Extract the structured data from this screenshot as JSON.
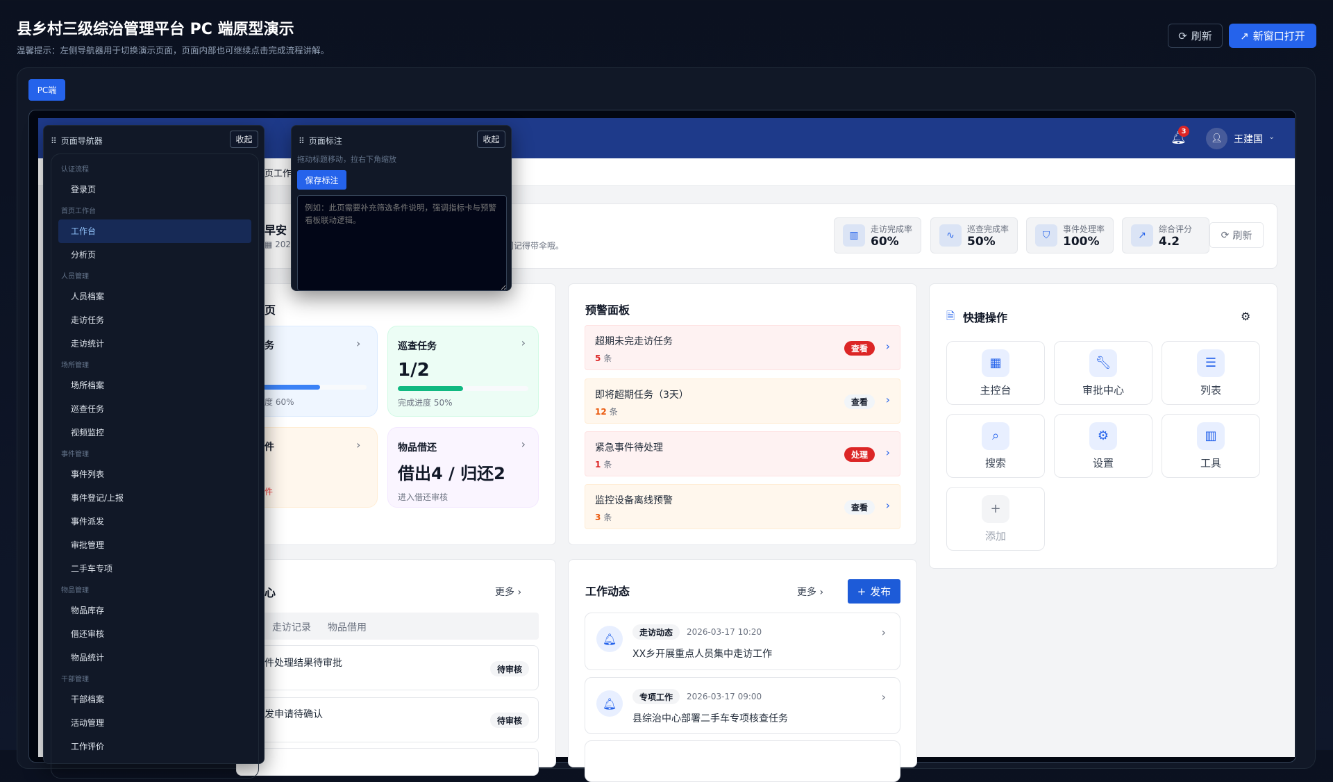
{
  "header": {
    "title": "县乡村三级综治管理平台 PC 端原型演示",
    "subtitle": "温馨提示：左侧导航器用于切换演示页面，页面内部也可继续点击完成流程讲解。",
    "refresh_label": "刷新",
    "open_new_label": "新窗口打开"
  },
  "device_tab": "PC端",
  "app": {
    "notification_count": "3",
    "user_name": "王建国",
    "breadcrumb_fragment": "页工作",
    "welcome": {
      "greeting_fragment": "早安 ,",
      "date_fragment": "202",
      "tip_fragment": "门记得带伞哦。"
    },
    "stats": [
      {
        "label": "走访完成率",
        "value": "60%",
        "icon": "bar-chart-icon"
      },
      {
        "label": "巡查完成率",
        "value": "50%",
        "icon": "activity-icon"
      },
      {
        "label": "事件处理率",
        "value": "100%",
        "icon": "shield-alert-icon"
      },
      {
        "label": "综合评分",
        "value": "4.2",
        "icon": "arrow-up-right-icon"
      }
    ],
    "stats_refresh": "刷新",
    "tasks": {
      "title_fragment": "页",
      "cards": [
        {
          "title_fragment": "务",
          "progress_label_fragment": "度 60%",
          "progress": 60,
          "color": "#3b82f6"
        },
        {
          "title": "巡查任务",
          "value": "1/2",
          "progress_label": "完成进度 50%",
          "progress": 50,
          "color": "#10b981"
        },
        {
          "title_fragment": "件",
          "sub_fragment": "件"
        },
        {
          "title": "物品借还",
          "value": "借出4 / 归还2",
          "sub": "进入借还审核"
        }
      ]
    },
    "alerts": {
      "title": "预警面板",
      "items": [
        {
          "title": "超期未完走访任务",
          "count": "5",
          "unit": "条",
          "action": "查看",
          "level": "danger"
        },
        {
          "title": "即将超期任务（3天）",
          "count": "12",
          "unit": "条",
          "action": "查看",
          "level": "warning"
        },
        {
          "title": "紧急事件待处理",
          "count": "1",
          "unit": "条",
          "action": "处理",
          "level": "danger"
        },
        {
          "title": "监控设备离线预警",
          "count": "3",
          "unit": "条",
          "action": "查看",
          "level": "warning"
        }
      ]
    },
    "quick": {
      "title": "快捷操作",
      "items": [
        {
          "label": "主控台",
          "icon": "grid-icon"
        },
        {
          "label": "审批中心",
          "icon": "wrench-icon"
        },
        {
          "label": "列表",
          "icon": "list-icon"
        },
        {
          "label": "搜索",
          "icon": "search-icon"
        },
        {
          "label": "设置",
          "icon": "gear-icon"
        },
        {
          "label": "工具",
          "icon": "bar-chart-icon"
        },
        {
          "label": "添加",
          "icon": "plus-icon"
        }
      ]
    },
    "todo": {
      "title_fragment": "心",
      "more": "更多",
      "tabs": [
        "走访记录",
        "物品借用"
      ],
      "items": [
        {
          "text_fragment": "件处理结果待审批",
          "status": "待审核"
        },
        {
          "text_fragment": "发申请待确认",
          "status": "待审核"
        }
      ]
    },
    "feed": {
      "title": "工作动态",
      "more": "更多",
      "publish": "发布",
      "items": [
        {
          "tag": "走访动态",
          "time": "2026-03-17 10:20",
          "text": "XX乡开展重点人员集中走访工作"
        },
        {
          "tag": "专项工作",
          "time": "2026-03-17 09:00",
          "text": "县综治中心部署二手车专项核查任务"
        }
      ]
    }
  },
  "navigator": {
    "title": "页面导航器",
    "collapse": "收起",
    "sections": [
      {
        "label": "认证流程",
        "items": [
          "登录页"
        ]
      },
      {
        "label": "首页工作台",
        "items": [
          "工作台",
          "分析页"
        ]
      },
      {
        "label": "人员管理",
        "items": [
          "人员档案",
          "走访任务",
          "走访统计"
        ]
      },
      {
        "label": "场所管理",
        "items": [
          "场所档案",
          "巡查任务",
          "视频监控"
        ]
      },
      {
        "label": "事件管理",
        "items": [
          "事件列表",
          "事件登记/上报",
          "事件派发",
          "审批管理",
          "二手车专项"
        ]
      },
      {
        "label": "物品管理",
        "items": [
          "物品库存",
          "借还审核",
          "物品统计"
        ]
      },
      {
        "label": "干部管理",
        "items": [
          "干部档案",
          "活动管理",
          "工作评价"
        ]
      }
    ],
    "selected": "工作台"
  },
  "annotation": {
    "title": "页面标注",
    "collapse": "收起",
    "hint": "拖动标题移动，拉右下角缩放",
    "save": "保存标注",
    "placeholder": "例如：此页需要补充筛选条件说明，强调指标卡与预警看板联动逻辑。"
  }
}
